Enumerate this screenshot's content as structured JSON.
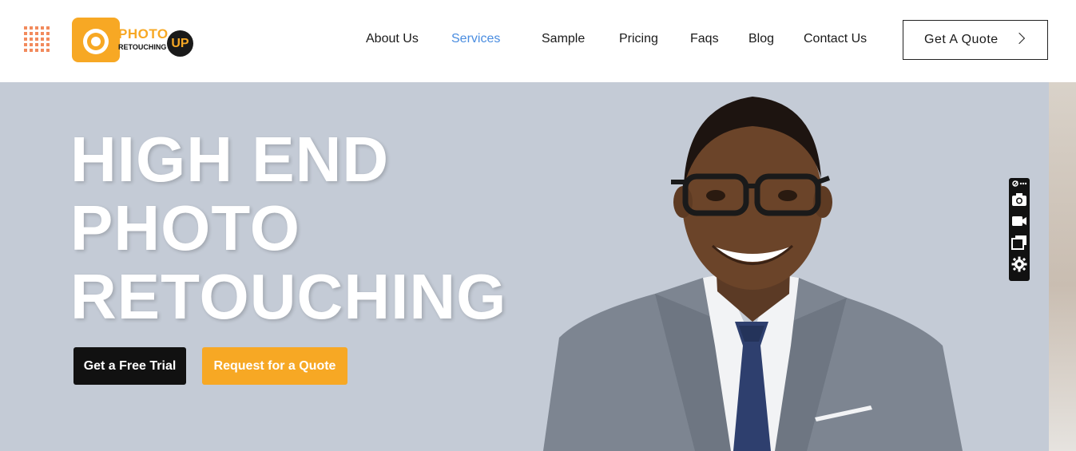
{
  "header": {
    "logo": {
      "top": "PHOTO",
      "bottom": "RETOUCHING",
      "badge": "UP"
    },
    "nav": [
      {
        "label": "About Us"
      },
      {
        "label": "Services",
        "active": true
      },
      {
        "label": "Sample"
      },
      {
        "label": "Pricing"
      },
      {
        "label": "Faqs"
      },
      {
        "label": "Blog"
      },
      {
        "label": "Contact Us"
      }
    ],
    "cta_label": "Get A Quote"
  },
  "hero": {
    "headline_lines": [
      "HIGH END",
      "PHOTO",
      "RETOUCHING"
    ],
    "btn_trial": "Get a Free Trial",
    "btn_quote": "Request for a Quote"
  },
  "toolbar": {
    "icons": [
      "link-icon",
      "more-icon",
      "camera-icon",
      "video-icon",
      "gallery-icon",
      "gear-icon"
    ]
  },
  "colors": {
    "accent": "#f7a824",
    "nav_active": "#4a8de0",
    "hero_bg": "#c4cbd6",
    "grid_icon": "#f28a5c"
  }
}
